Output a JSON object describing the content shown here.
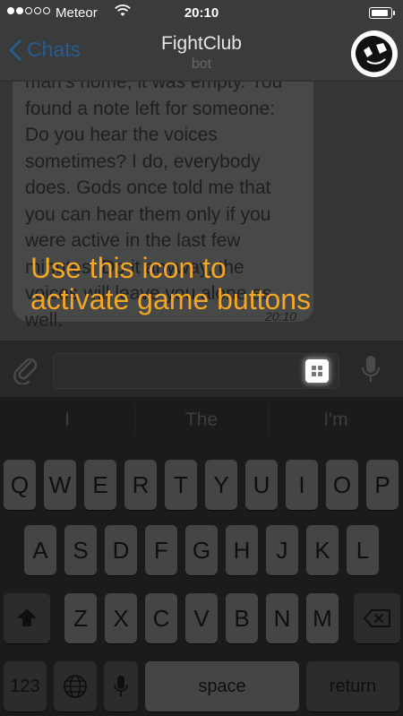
{
  "status_bar": {
    "carrier": "Meteor",
    "time": "20:10",
    "signal_bars_filled": 2,
    "signal_bars_total": 5
  },
  "nav": {
    "back_label": "Chats",
    "title": "FightClub",
    "subtitle": "bot"
  },
  "message": {
    "text": "man's home, it was empty. You\nfound a note left for someone:\nDo you hear the voices\nsometimes? I do, everybody\ndoes. Gods once told me that\nyou can hear them only if you\nwere active in the last few\nminutes. Do it anyway, the\nvoices will leave you alone as\nwell.",
    "time": "20:10"
  },
  "overlay": {
    "text": "Use this icon to\nactivate game buttons"
  },
  "input_bar": {
    "placeholder": ""
  },
  "suggestions": [
    "I",
    "The",
    "I'm"
  ],
  "keyboard": {
    "row1": [
      "Q",
      "W",
      "E",
      "R",
      "T",
      "Y",
      "U",
      "I",
      "O",
      "P"
    ],
    "row2": [
      "A",
      "S",
      "D",
      "F",
      "G",
      "H",
      "J",
      "K",
      "L"
    ],
    "row3": [
      "Z",
      "X",
      "C",
      "V",
      "B",
      "N",
      "M"
    ],
    "numbers_key": "123",
    "space_key": "space",
    "return_key": "return"
  },
  "icons": {
    "back": "chevron-left-icon",
    "wifi": "wifi-icon",
    "battery": "battery-icon",
    "attach": "paperclip-icon",
    "game": "game-buttons-icon",
    "mic": "microphone-icon",
    "shift": "shift-icon",
    "backspace": "backspace-icon",
    "globe": "globe-icon"
  },
  "colors": {
    "back_link": "#2a5b8c",
    "overlay_text": "#f5a623",
    "bubble": "#474848"
  }
}
